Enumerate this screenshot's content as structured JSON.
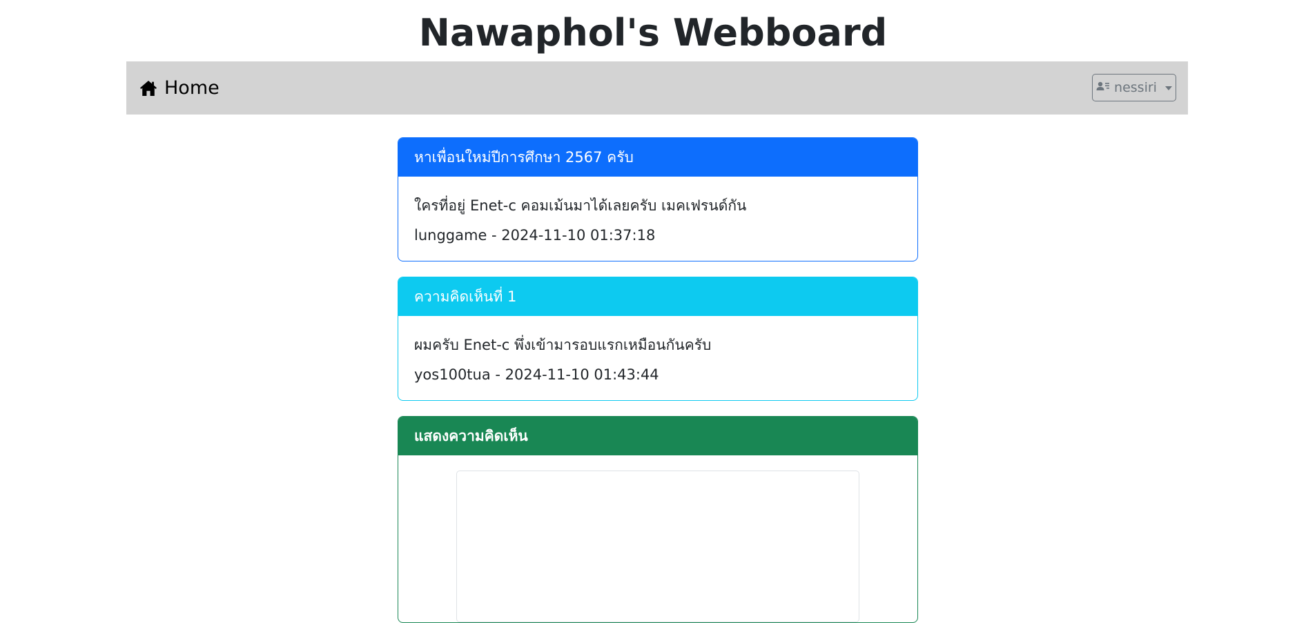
{
  "header": {
    "title": "Nawaphol's Webboard"
  },
  "navbar": {
    "home_label": "Home",
    "home_icon": "house-icon",
    "user": {
      "label": "nessiri",
      "icon": "person-lines-icon"
    }
  },
  "topic": {
    "title": "หาเพื่อนใหม่ปีการศึกษา 2567 ครับ",
    "content": "ใครที่อยู่ Enet-c คอมเม้นมาได้เลยครับ เมคเฟรนด์กัน",
    "meta": "lunggame - 2024-11-10 01:37:18"
  },
  "comments": [
    {
      "header": "ความคิดเห็นที่ 1",
      "content": "ผมครับ Enet-c พึ่งเข้ามารอบแรกเหมือนกันครับ",
      "meta": "yos100tua - 2024-11-10 01:43:44"
    }
  ],
  "reply": {
    "header": "แสดงความคิดเห็น",
    "value": ""
  },
  "colors": {
    "topic": "#0d6efd",
    "comment": "#0dcaf0",
    "reply": "#198754",
    "navbar": "#d3d3d3"
  }
}
